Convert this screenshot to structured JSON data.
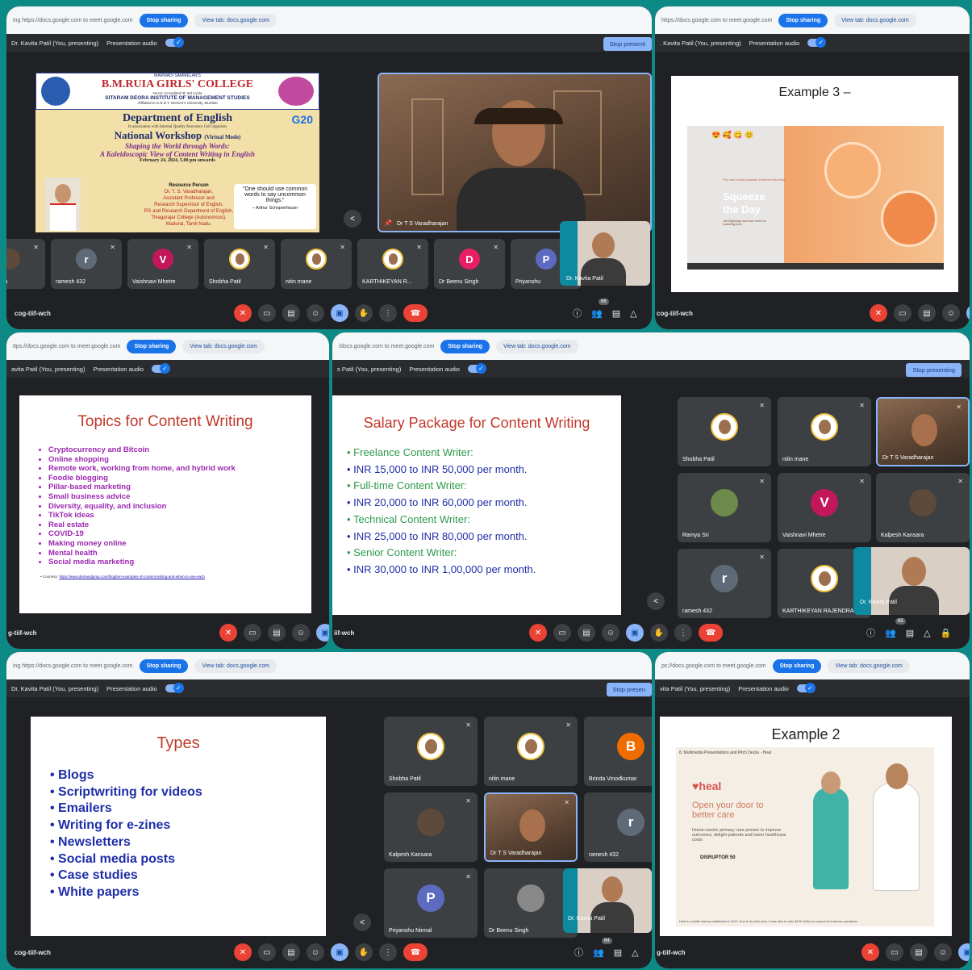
{
  "common": {
    "tab_url_full": "Sharing https://docs.google.com to meet.google.com",
    "stop_sharing": "Stop sharing",
    "view_tab": "View tab: docs.google.com",
    "presenting_full": "Dr. Kavita Patil (You, presenting)",
    "presentation_audio": "Presentation audio",
    "stop_presenting": "Stop presenting",
    "meeting_code": "cog-tiif-wch"
  },
  "p1": {
    "url": "ing https://docs.google.com to meet.google.com",
    "presenting": "Dr. Kavita Patil (You, presenting)",
    "stop_presenting": "Stop presenti",
    "poster": {
      "org_top": "MARWADI SAMMELAN'S",
      "college": "B.M.RUIA GIRLS' COLLEGE",
      "naac": "NAAC Accredited 'B' 3rd Cycle",
      "institute": "SITARAM DEORA INSTITUTE OF MANAGEMENT STUDIES",
      "affiliation": "Affiliated to S.N.D.T. Women's University, Mumbai",
      "dept": "Department of English",
      "association": "In association with Internal Quality Assurance Cell organises",
      "workshop": "National Workshop",
      "mode": "(Virtual Mode)",
      "theme1": "Shaping the World through Words:",
      "theme2": "A Kaleidoscopic View of Content Writing in English",
      "date": "February 24, 2024, 5.00 pm onwards",
      "rp_label": "Resource Person",
      "rp_name": "Dr. T. S. Varadharajan,",
      "rp_l1": "Assistant Professor and",
      "rp_l2": "Research Supervisor of English,",
      "rp_l3": "PG and Research Department of English,",
      "rp_l4": "Thiagarajar College (Autonomous),",
      "rp_l5": "Madurai, Tamil Nadu.",
      "quote": "\"One should use common words to say uncommon things.\"",
      "quote_author": "– Arthur Schopenhauer",
      "g20": "G20"
    },
    "speaker": "Dr T S Varadharajan",
    "self": "Dr. Kavita Patil",
    "tiles": [
      {
        "name": "sh Kansara",
        "initial": "",
        "color": "#5d4a3a"
      },
      {
        "name": "ramesh 432",
        "initial": "r",
        "color": "#5f6a78"
      },
      {
        "name": "Vaishnavi Mhetre",
        "initial": "V",
        "color": "#c2185b"
      },
      {
        "name": "Shobha Patil",
        "initial": "",
        "color": "#ffffff"
      },
      {
        "name": "nitin mane",
        "initial": "",
        "color": "#ffffff"
      },
      {
        "name": "KARTHIKEYAN R...",
        "initial": "",
        "color": "#ffffff"
      },
      {
        "name": "Dr Beenu Singh",
        "initial": "D",
        "color": "#e91e63"
      },
      {
        "name": "Priyanshu",
        "initial": "P",
        "color": "#5c6bc0"
      }
    ],
    "participant_count": "68"
  },
  "p2": {
    "url": "https://docs.google.com to meet.google.com",
    "presenting": ". Kavita Patil (You, presenting)",
    "title": "Example 3 –",
    "photo_text1": "Five and Useful Updates Delivered Monthly!",
    "photo_text2": "Squeeze",
    "photo_text3": "the Day",
    "photo_text4": "Join BigDesign and learn more fun marketing tools"
  },
  "p3": {
    "url": "ttps://docs.google.com to meet.google.com",
    "presenting": "avita Patil (You, presenting)",
    "title": "Topics for Content Writing",
    "items": [
      "Cryptocurrency and Bitcoin",
      "Online shopping",
      "Remote work, working from home, and hybrid work",
      "Foodie blogging",
      "Pillar-based marketing",
      "Small business advice",
      "Diversity, equality, and inclusion",
      "TikTok ideas",
      "Real estate",
      "COVID-19",
      "Making money online",
      "Mental health",
      "Social media marketing"
    ],
    "courtesy_label": "Courtesy: ",
    "courtesy_link": "https://www.demandjump.com/blog/ten-examples-of-content-writing-and-when-to-use-each",
    "code": "g-tiif-wch"
  },
  "p4": {
    "url": "/docs.google.com to meet.google.com",
    "presenting": "s Patil (You, presenting)",
    "title": "Salary Package for Content Writing",
    "items": [
      {
        "text": "Freelance Content Writer:",
        "green": true
      },
      {
        "text": "INR 15,000 to INR 50,000 per month.",
        "green": false
      },
      {
        "text": "Full-time Content Writer:",
        "green": true
      },
      {
        "text": "INR 20,000 to INR 60,000 per month.",
        "green": false
      },
      {
        "text": "Technical Content Writer:",
        "green": true
      },
      {
        "text": "INR 25,000 to INR 80,000 per month.",
        "green": false
      },
      {
        "text": "Senior Content Writer:",
        "green": true
      },
      {
        "text": "INR 30,000 to INR 1,00,000 per month.",
        "green": false
      }
    ],
    "tiles": [
      {
        "name": "Shobha Patil",
        "initial": "",
        "color": "#ffffff"
      },
      {
        "name": "nitin mane",
        "initial": "",
        "color": "#ffffff"
      },
      {
        "name": "Dr T S Varadharajan",
        "initial": "",
        "color": ""
      },
      {
        "name": "Ramya Sri",
        "initial": "",
        "color": "#6d8a4a"
      },
      {
        "name": "Vaishnavi Mhetre",
        "initial": "V",
        "color": "#c2185b"
      },
      {
        "name": "Kalpesh Kansara",
        "initial": "",
        "color": "#5d4a3a"
      },
      {
        "name": "ramesh 432",
        "initial": "r",
        "color": "#5f6a78"
      },
      {
        "name": "KARTHIKEYAN RAJENDRAN",
        "initial": "",
        "color": "#ffffff"
      }
    ],
    "self": "Dr. Kavita Patil",
    "code": "iif-wch",
    "participant_count": "65"
  },
  "p5": {
    "url": "ing https://docs.google.com to meet.google.com",
    "presenting": "Dr. Kavita Patil (You, presenting)",
    "stop_presenting": "Stop presen",
    "title": "Types",
    "items": [
      "Blogs",
      "Scriptwriting for videos",
      "Emailers",
      "Writing for e-zines",
      "Newsletters",
      "Social media posts",
      "Case studies",
      "White papers"
    ],
    "tiles": [
      {
        "name": "Shobha Patil",
        "initial": "",
        "color": "#ffffff"
      },
      {
        "name": "nitin mane",
        "initial": "",
        "color": "#ffffff"
      },
      {
        "name": "Brinda Vinodkumar",
        "initial": "B",
        "color": "#ef6c00"
      },
      {
        "name": "Kalpesh Kansara",
        "initial": "",
        "color": "#5d4a3a"
      },
      {
        "name": "Dr T S Varadharajan",
        "initial": "",
        "color": ""
      },
      {
        "name": "ramesh 432",
        "initial": "r",
        "color": "#5f6a78"
      },
      {
        "name": "Priyanshu Nirmal",
        "initial": "P",
        "color": "#5c6bc0"
      },
      {
        "name": "Dr Beenu Singh",
        "initial": "",
        "color": "#888888"
      }
    ],
    "self": "Dr. Kavita Patil",
    "participant_count": "64"
  },
  "p6": {
    "url": "ps://docs.google.com to meet.google.com",
    "presenting": "vita Patil (You, presenting)",
    "title": "Example 2",
    "caption": "8. Multimedia Presentations and Pitch Decks - Heal",
    "brand": "heal",
    "headline": "Open your door to better care",
    "sub": "Home-centric primary care proven to improve outcomes, delight patients and lower healthcare costs",
    "award": "DISRUPTOR 50",
    "footer": "Heal is a health startup established in 2014. Due to its pitch deck, it was able to raise $100 million to expand its business operations",
    "code": "g-tiif-wch"
  }
}
